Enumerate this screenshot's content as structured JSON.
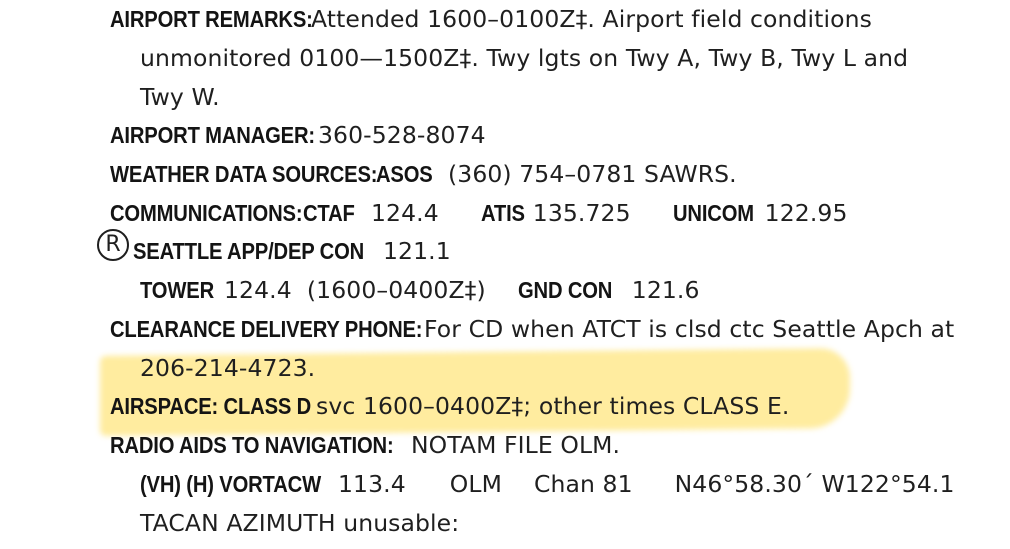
{
  "airport_remarks": {
    "label": "AIRPORT REMARKS:",
    "text_line1": "Attended 1600–0100Z‡. Airport field conditions",
    "text_line2": "unmonitored 0100—1500Z‡. Twy lgts on Twy A, Twy B, Twy L and",
    "text_line3": "Twy W."
  },
  "airport_manager": {
    "label": "AIRPORT MANAGER:",
    "value": "360-528-8074"
  },
  "weather_data_sources": {
    "label": "WEATHER DATA SOURCES:",
    "asos_label": "ASOS",
    "value": "(360) 754–0781 SAWRS."
  },
  "communications": {
    "label": "COMMUNICATIONS:",
    "ctaf_label": "CTAF",
    "ctaf_value": "124.4",
    "atis_label": "ATIS",
    "atis_value": "135.725",
    "unicom_label": "UNICOM",
    "unicom_value": "122.95",
    "radar_symbol": "R",
    "app_dep_label": "SEATTLE APP/DEP CON",
    "app_dep_value": "121.1",
    "tower_label": "TOWER",
    "tower_value": "124.4  (1600–0400Z‡)",
    "gnd_label": "GND CON",
    "gnd_value": "121.6"
  },
  "clearance_delivery": {
    "label": "CLEARANCE DELIVERY PHONE:",
    "text_line1": "For CD when ATCT is clsd ctc Seattle Apch at",
    "text_line2": "206-214-4723."
  },
  "airspace": {
    "label": "AIRSPACE: CLASS D",
    "text": "svc 1600–0400Z‡; other times CLASS E."
  },
  "radio_aids": {
    "label": "RADIO AIDS TO NAVIGATION:",
    "text": "NOTAM FILE OLM.",
    "vortac_label": "(VH) (H) VORTACW",
    "vortac_freq": "113.4",
    "vortac_id": "OLM",
    "vortac_chan": "Chan 81",
    "vortac_coords": "N46°58.30´ W122°54.1",
    "tacan_note": "TACAN AZIMUTH unusable:"
  },
  "highlight_color": "#ffdd50"
}
